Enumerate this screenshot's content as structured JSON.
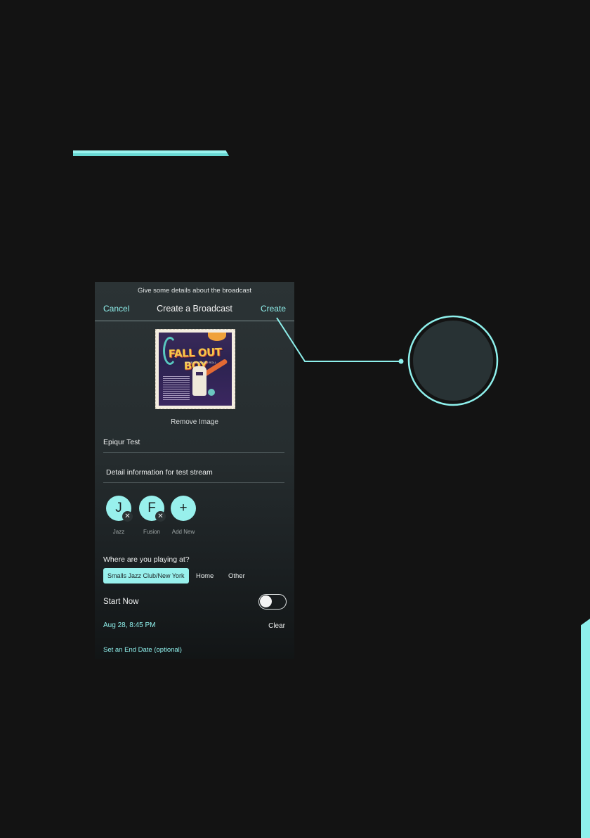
{
  "screen": {
    "subtitle": "Give some details about the broadcast",
    "nav": {
      "cancel_label": "Cancel",
      "title": "Create a Broadcast",
      "create_label": "Create"
    },
    "remove_image_label": "Remove Image",
    "poster_text": {
      "title": "FALL OUT BOY",
      "sub": "SAVE ROCK AND ROLL"
    },
    "name_field": {
      "value": "Epiqur Test"
    },
    "description_field": {
      "value": "Detail information for test stream"
    },
    "tags": [
      {
        "letter": "J",
        "remove_glyph": "✕",
        "label": "Jazz"
      },
      {
        "letter": "F",
        "remove_glyph": "✕",
        "label": "Fusion"
      },
      {
        "letter": "+",
        "label": "Add New"
      }
    ],
    "location": {
      "question": "Where are you playing at?",
      "selected": "Smalls Jazz Club/New York",
      "options": [
        "Home",
        "Other"
      ]
    },
    "start_now": {
      "label": "Start Now",
      "on": false
    },
    "start_date": "Aug 28, 8:45 PM",
    "clear_label": "Clear",
    "end_date_label": "Set an End Date (optional)"
  },
  "colors": {
    "background": "#131313",
    "accent": "#98f0ec",
    "phone_bg": "#2b3335"
  }
}
